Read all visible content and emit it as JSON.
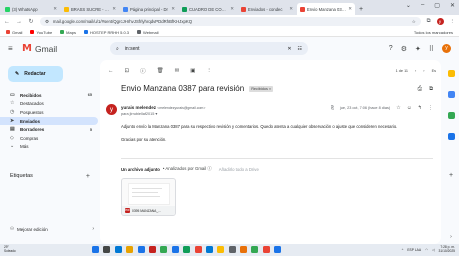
{
  "browser": {
    "tabs": [
      {
        "label": "(3) WhatsApp",
        "color": "#25d366",
        "active": false
      },
      {
        "label": "BRASS SUCRE - Gou",
        "color": "#fbbc04",
        "active": false
      },
      {
        "label": "Página principal - Dr",
        "color": "#4285f4",
        "active": false
      },
      {
        "label": "CUADRO DE CORTO",
        "color": "#0f9d58",
        "active": false
      },
      {
        "label": "Enviados - condec",
        "color": "#ea4335",
        "active": false
      },
      {
        "label": "Envio Manzana 0387",
        "color": "#ea4335",
        "active": true
      }
    ],
    "new_tab": "+",
    "window_controls": [
      "⌄",
      "–",
      "▢",
      "✕"
    ],
    "url": "mail.google.com/mail/u/1/#sent/QgrcJHrhvJSfrlyhrqdvPDdRhBfKHJxpKQ",
    "bookmarks": [
      {
        "label": "Gmail",
        "color": "#ea4335"
      },
      {
        "label": "YouTube",
        "color": "#ff0000"
      },
      {
        "label": "Maps",
        "color": "#34a853"
      },
      {
        "label": "HOSTEP RRHH 5.0.3",
        "color": "#1a73e8"
      },
      {
        "label": "Webmail",
        "color": "#5f6368"
      }
    ],
    "bookmarks_right": "Todos los marcadores",
    "profile_initial": "y"
  },
  "gmail": {
    "logo_text": "Gmail",
    "search_value": "in:sent",
    "avatar_initial": "y"
  },
  "sidebar": {
    "compose_label": "Redactar",
    "items": [
      {
        "icon": "▭",
        "label": "Recibidos",
        "count": "65",
        "bold": true
      },
      {
        "icon": "☆",
        "label": "Destacados",
        "count": ""
      },
      {
        "icon": "◷",
        "label": "Pospuestos",
        "count": ""
      },
      {
        "icon": "➤",
        "label": "Enviados",
        "count": "",
        "active": true
      },
      {
        "icon": "▤",
        "label": "Borradores",
        "count": "5",
        "bold": true
      },
      {
        "icon": "◇",
        "label": "Compras",
        "count": ""
      },
      {
        "icon": "⌄",
        "label": "Más",
        "count": ""
      }
    ],
    "labels_title": "Etiquetas",
    "upgrade_label": "Mejorar edición"
  },
  "mail": {
    "pager": "1 de 11",
    "lang_label": "Es",
    "subject": "Envio Manzana 0387 para revisión",
    "subject_chip": "Recibidos ×",
    "sender_initial": "y",
    "sender_name": "yurais melendez",
    "sender_email": "<melendezyurais@gmail.com>",
    "to_line": "para jlrrubiellaf2015 ▾",
    "date": "jue, 23 oct, 7:06 (hace 8 días)",
    "body_line1": "Adjunto envío la Manzana 0387 para su respectivo revisión y comentarios. Quedo atenta a cualquier observación o ajuste que consideren necesario.",
    "body_line2": "Gracias por su atención.",
    "attach_title": "Un archivo adjunto",
    "attach_scan": "• Analizados por Gmail ⓘ",
    "attach_drive": "Añadirlo todo a Drive",
    "attach_name": "0395 MANZANA_...",
    "attach_badge": "PDF"
  },
  "taskbar": {
    "temp": "29°",
    "weather": "Soleado",
    "lang": "ESP LAA",
    "time": "7:28 p. m.",
    "date": "31/10/2025",
    "icons": [
      "#1a73e8",
      "#444746",
      "#0078d4",
      "#e8a200",
      "#1a73e8",
      "#c5221f",
      "#34a853",
      "#1a73e8",
      "#0f9d58",
      "#ea4335",
      "#0078d4",
      "#fbbc04",
      "#5f6368",
      "#e8710a",
      "#34a853",
      "#ea4335",
      "#1a73e8"
    ]
  },
  "sidepanel_colors": [
    "#fbbc04",
    "#4285f4",
    "#34a853",
    "#1a73e8"
  ]
}
